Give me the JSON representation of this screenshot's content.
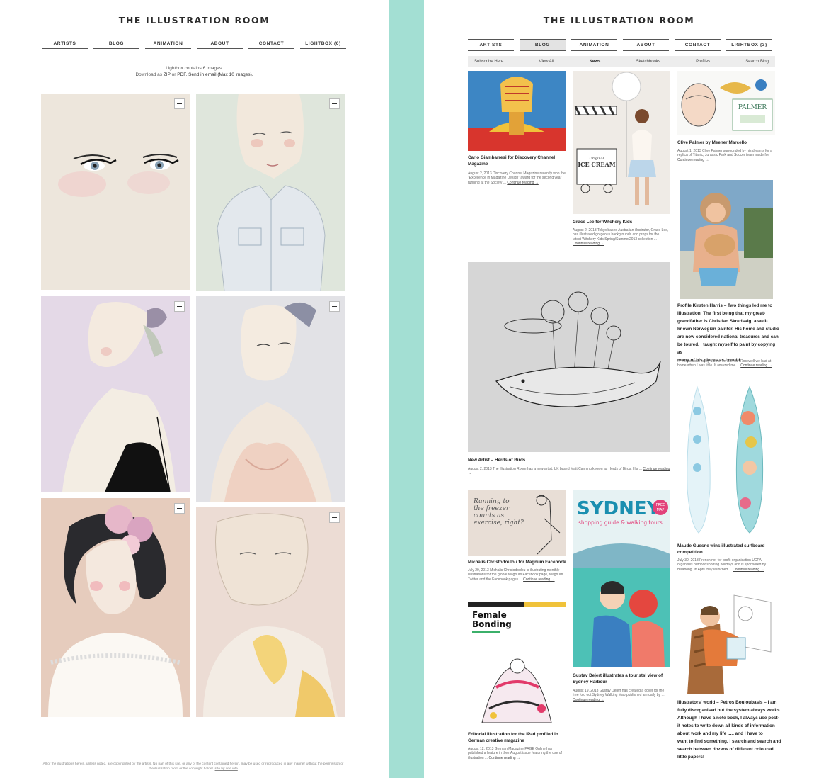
{
  "left": {
    "title": "THE ILLUSTRATION ROOM",
    "nav": [
      "ARTISTS",
      "BLOG",
      "ANIMATION",
      "ABOUT",
      "CONTACT",
      "LIGHTBOX (6)"
    ],
    "lightbox": {
      "line1": "Lightbox contains 6 images.",
      "line2_prefix": "Download as",
      "zip": "ZIP",
      "or": "or",
      "pdf": "PDF",
      "send": "Send in email (Max 10 images)",
      "period": "."
    },
    "footer": {
      "text": "All of the illustrations herein, unless noted, are copyrighted by the artists. No part of this site, or any of the content contained herein, may be used or reproduced in any manner without the permission of the illustration room or the copyright holder.",
      "credit": "site by one iota"
    },
    "colors": {
      "accent_divider": "#a3dfd3"
    }
  },
  "right": {
    "title": "THE ILLUSTRATION ROOM",
    "nav": [
      "ARTISTS",
      "BLOG",
      "ANIMATION",
      "ABOUT",
      "CONTACT",
      "LIGHTBOX (3)"
    ],
    "subnav": [
      "Subscribe Here",
      "View All",
      "News",
      "Sketchbooks",
      "Profiles",
      "Search Blog"
    ],
    "posts": {
      "p1": {
        "title1": "Carlo Giambarresi for Discovery Channel",
        "title2": "Magazine",
        "body": [
          "August 2, 2013 Discovery Channel Magazine recently won the",
          "\"Excellence in Magazine Design\" award for the second year",
          "running at the Society ..."
        ],
        "more": "Continue reading →"
      },
      "p2": {
        "title1": "Grace Lee for Witchery Kids",
        "body": [
          "August 2, 2013 Tokyo based Australian illustrator, Grace Lee,",
          "has illustrated gorgeous backgrounds and props for the",
          "latest Witchery Kids Spring/Summer2013 collection ..."
        ],
        "more": "Continue reading →"
      },
      "p3": {
        "title1": "Clive Palmer by Meener Marcello",
        "body": [
          "August 1, 2013 Clive Palmer surrounded by his dreams for a",
          "replica of Titanic, Jurassic Park and Soccer team made for"
        ],
        "more": "Continue reading →"
      },
      "p4": {
        "title": "Profile Kirsten Harris – Two things led me to",
        "lines": [
          "illustration. The first being that my great-",
          "grandfather is Christian Skredsvig, a well-",
          "known Norwegian painter. His home and studio",
          "are now considered national treasures and can",
          "be toured. I taught myself to paint by copying as",
          "many of his pieces as I could."
        ],
        "body": [
          "... The second being a book on Norman Rockwell we had at",
          "home when I was little. It amazed me ..."
        ],
        "more": "Continue reading →"
      },
      "p5": {
        "title1": "New Artist – Herds of Birds",
        "body": [
          "August 2, 2013 The Illustration Room has a new artist, UK based Matt Canning known as Herds of Birds. His ..."
        ],
        "more": "Continue reading →"
      },
      "p6": {
        "title1": "Michalis Christodoulou for Magnum Facebook",
        "body": [
          "July 29, 2013 Michalis Christodoulou is illustrating monthly",
          "illustrations for the global Magnum Facebook page, Magnum",
          "Twitter and the Facebook pages ..."
        ],
        "more": "Continue reading →"
      },
      "p7": {
        "title1": "Maude Guesne wins illustrated surfboard",
        "title2": "competition",
        "body": [
          "July 30, 2013 French not-for-profit organisation UCPA",
          "organises outdoor sporting holidays and is sponsored by",
          "Billabong. In April they launched ..."
        ],
        "more": "Continue reading →"
      },
      "p8": {
        "title1": "Gustav Dejert illustrates a tourists' view of",
        "title2": "Sydney Harbour",
        "body": [
          "August 19, 2013 Gustav Dejert has created a cover for the",
          "free fold out Sydney Walking Map published annually by ..."
        ],
        "more": "Continue reading →"
      },
      "p9": {
        "title1": "Editorial illustration for the iPad profiled in",
        "title2": "German creative magazine",
        "body": [
          "August 12, 2013 German Magazine PAGE Online has",
          "published a feature in their August issue featuring the use of",
          "illustration ..."
        ],
        "more": "Continue reading →"
      },
      "p10": {
        "title": "Illustrators' world – Petros Bouloubasis – I am",
        "lines": [
          "fully disorganised but the system always works.",
          "Although I have a note book, I always use post-",
          "it notes to write down all kinds of information",
          "about work and my life ..... and I have to",
          "want to find something, I search and search and",
          "search between dozens of different coloured",
          "little papers!"
        ]
      }
    },
    "image_text": {
      "palmer": "PALMER",
      "icecream_small": "Original",
      "icecream": "ICE CREAM",
      "freezer": [
        "Running to",
        "the freezer",
        "counts as",
        "exercise, right?"
      ],
      "sydney": "SYDNEY",
      "sydney_sub": "shopping guide & walking tours",
      "free_map": [
        "FREE",
        "MAP"
      ],
      "female": [
        "Female",
        "Bonding"
      ]
    }
  }
}
